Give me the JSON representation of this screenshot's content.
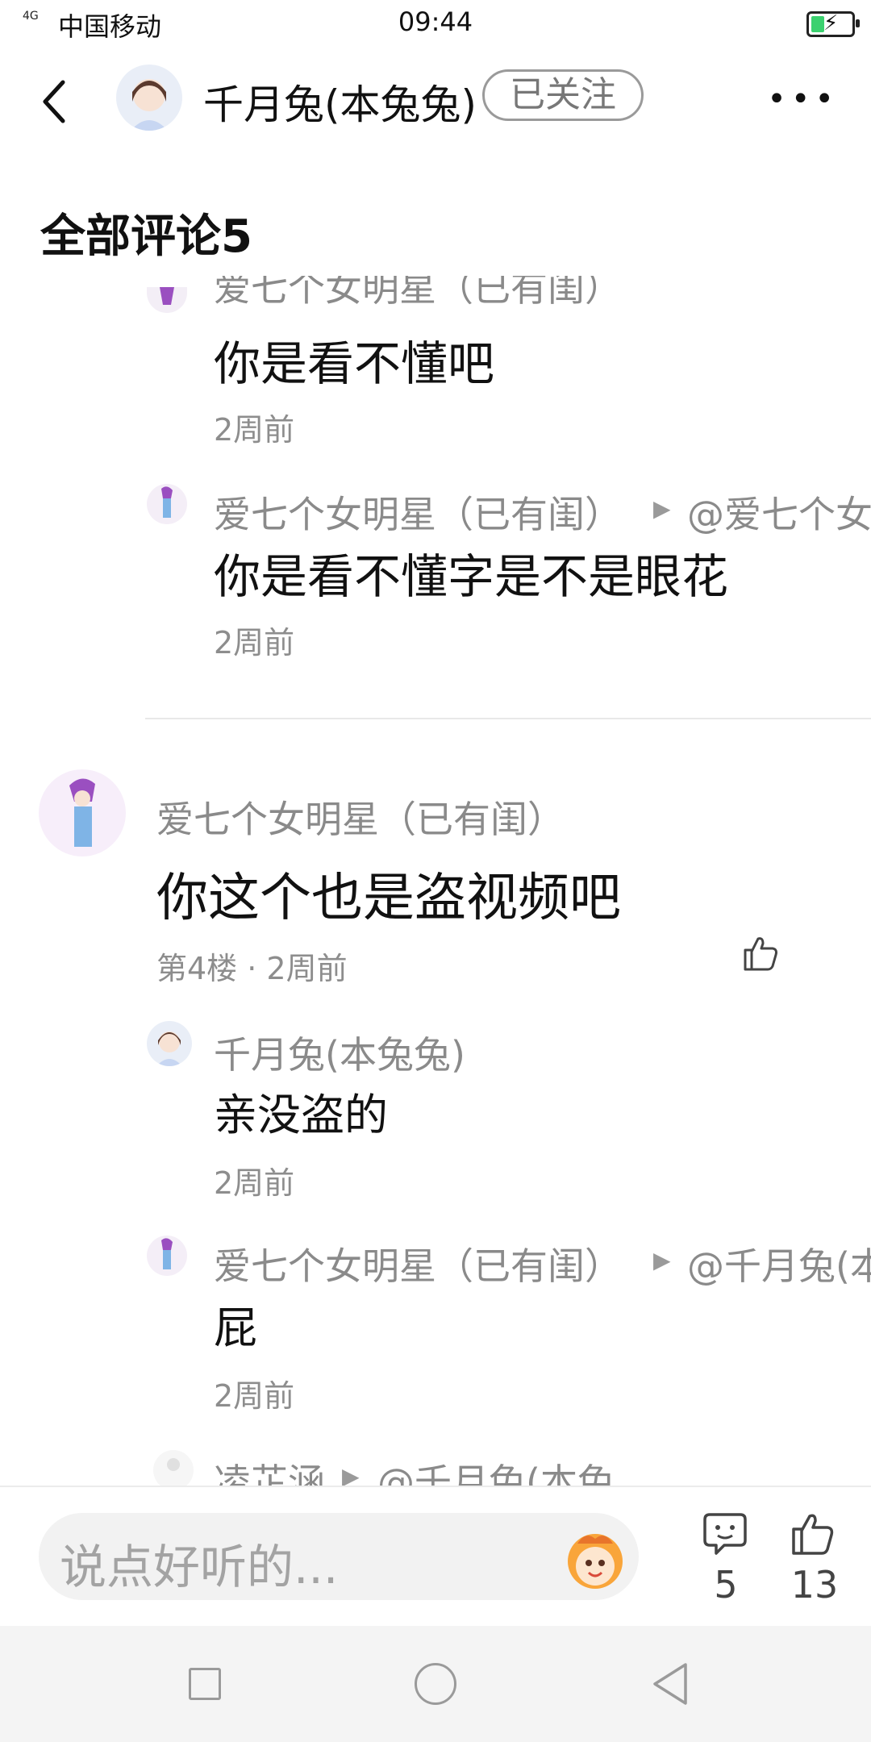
{
  "status": {
    "signal": "4G",
    "carrier": "中国移动",
    "time": "09:44"
  },
  "header": {
    "username": "千月兔(本兔兔)",
    "follow_label": "已关注"
  },
  "comments_title": "全部评论5",
  "comments": [
    {
      "name_partial": "爱七个女明星（已有闺）",
      "text": "你是看不懂吧",
      "time": "2周前"
    },
    {
      "name": "爱七个女明星（已有闺）",
      "at": "@爱七个女",
      "text": "你是看不懂字是不是眼花",
      "time": "2周前"
    },
    {
      "name": "爱七个女明星（已有闺）",
      "text": "你这个也是盗视频吧",
      "meta": "第4楼 · 2周前"
    },
    {
      "name": "千月兔(本兔兔)",
      "text": "亲没盗的",
      "time": "2周前"
    },
    {
      "name": "爱七个女明星（已有闺）",
      "at": "@千月兔(本",
      "text": "屁",
      "time": "2周前"
    },
    {
      "name": "凌芷涵",
      "at": "@千月兔(本兔..."
    }
  ],
  "input": {
    "placeholder": "说点好听的..."
  },
  "counts": {
    "comments": "5",
    "likes": "13"
  }
}
